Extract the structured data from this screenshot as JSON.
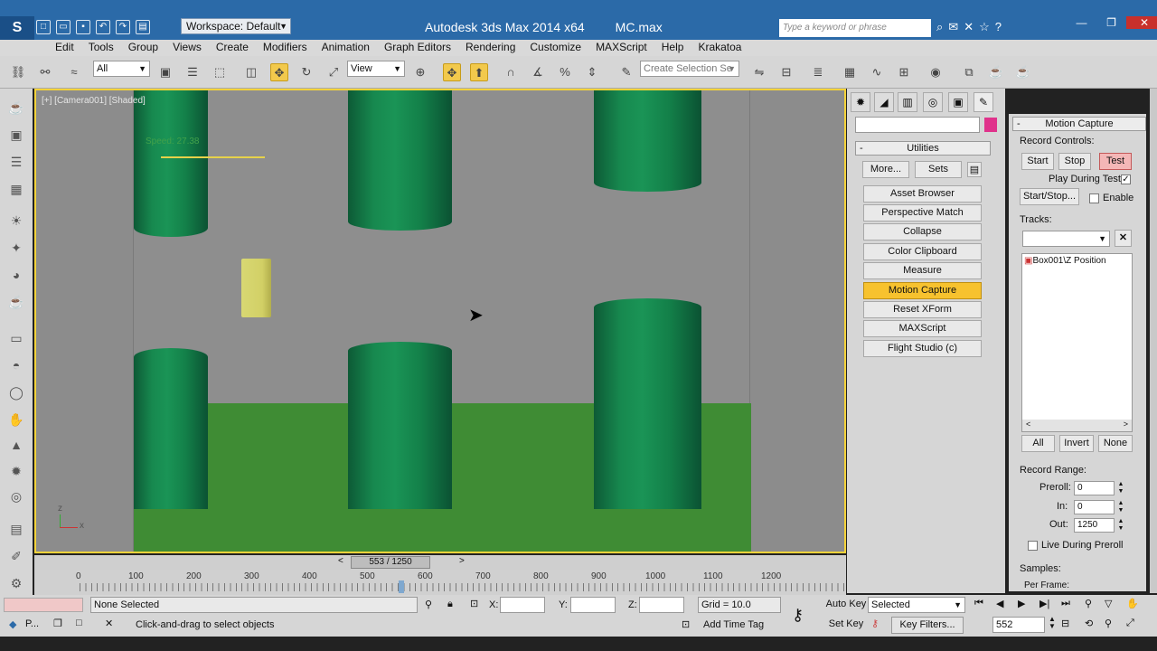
{
  "app": {
    "title": "Autodesk 3ds Max  2014 x64",
    "file": "MC.max",
    "workspace": "Workspace: Default",
    "search_placeholder": "Type a keyword or phrase"
  },
  "menu": [
    "Edit",
    "Tools",
    "Group",
    "Views",
    "Create",
    "Modifiers",
    "Animation",
    "Graph Editors",
    "Rendering",
    "Customize",
    "MAXScript",
    "Help",
    "Krakatoa"
  ],
  "toolbar": {
    "filter_value": "All",
    "refcoord_value": "View",
    "named_selection_placeholder": "Create Selection Se"
  },
  "viewport": {
    "label": "[+] [Camera001] [Shaded]",
    "speed_text": "Speed: 27.38",
    "axis_x": "x",
    "axis_y": "z"
  },
  "command_panel": {
    "utilities_header": "Utilities",
    "more_button": "More...",
    "sets_button": "Sets",
    "utilities": [
      "Asset Browser",
      "Perspective Match",
      "Collapse",
      "Color Clipboard",
      "Measure",
      "Motion Capture",
      "Reset XForm",
      "MAXScript",
      "Flight Studio (c)"
    ],
    "active_utility": "Motion Capture"
  },
  "motion_capture": {
    "header": "Motion Capture",
    "record_controls_label": "Record Controls:",
    "start_button": "Start",
    "stop_button": "Stop",
    "test_button": "Test",
    "play_during_test_label": "Play During Test",
    "play_during_test_checked": true,
    "start_stop_button": "Start/Stop...",
    "enable_label": "Enable",
    "enable_checked": false,
    "tracks_label": "Tracks:",
    "tracks": [
      "Box001\\Z Position"
    ],
    "all_button": "All",
    "invert_button": "Invert",
    "none_button": "None",
    "record_range_label": "Record Range:",
    "preroll_label": "Preroll:",
    "preroll_value": "0",
    "in_label": "In:",
    "in_value": "0",
    "out_label": "Out:",
    "out_value": "1250",
    "live_during_preroll_label": "Live During Preroll",
    "samples_label": "Samples:",
    "per_frame_label": "Per Frame:"
  },
  "timeline": {
    "slider_text": "553 / 1250",
    "ticks": [
      "0",
      "100",
      "200",
      "300",
      "400",
      "500",
      "600",
      "700",
      "800",
      "900",
      "1000",
      "1100",
      "1200"
    ]
  },
  "status": {
    "selection_text": "None Selected",
    "prompt_text": "Click-and-drag to select objects",
    "x_label": "X:",
    "y_label": "Y:",
    "z_label": "Z:",
    "grid_text": "Grid = 10.0",
    "add_time_tag": "Add Time Tag",
    "auto_key": "Auto Key",
    "set_key": "Set Key",
    "selected_value": "Selected",
    "key_filters": "Key Filters...",
    "current_frame": "552",
    "taskbar_item": "P..."
  }
}
